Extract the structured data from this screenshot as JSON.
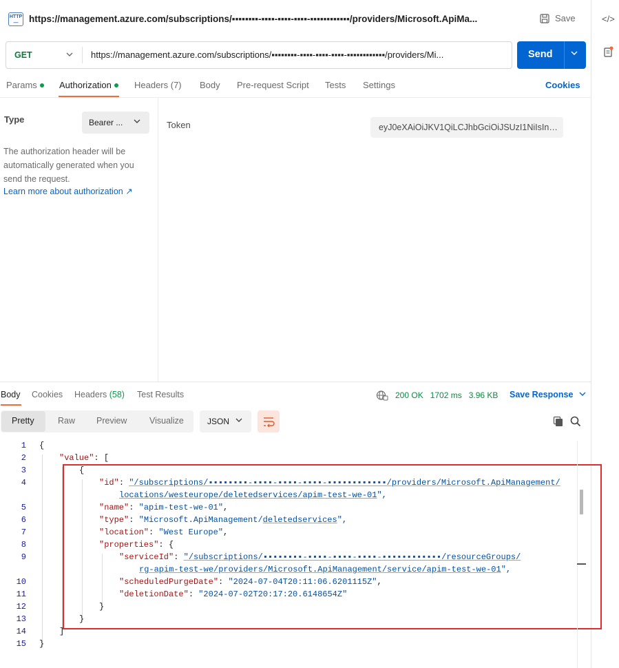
{
  "request": {
    "title": "https://management.azure.com/subscriptions/▪▪▪▪▪▪▪▪-▪▪▪▪-▪▪▪▪-▪▪▪▪-▪▪▪▪▪▪▪▪▪▪▪▪/providers/Microsoft.ApiMa...",
    "save_label": "Save",
    "method": "GET",
    "url": "https://management.azure.com/subscriptions/▪▪▪▪▪▪▪▪-▪▪▪▪-▪▪▪▪-▪▪▪▪-▪▪▪▪▪▪▪▪▪▪▪▪/providers/Mi...",
    "send_label": "Send",
    "tabs": [
      {
        "label": "Params",
        "dot": true
      },
      {
        "label": "Authorization",
        "dot": true,
        "active": true
      },
      {
        "label": "Headers (7)"
      },
      {
        "label": "Body"
      },
      {
        "label": "Pre-request Script"
      },
      {
        "label": "Tests"
      },
      {
        "label": "Settings"
      }
    ],
    "cookies_link": "Cookies"
  },
  "auth": {
    "type_label": "Type",
    "type_value": "Bearer ...",
    "description": "The authorization header will be automatically generated when you send the request.",
    "learn_more": "Learn more about authorization ↗",
    "token_label": "Token",
    "token_value": "eyJ0eXAiOiJKV1QiLCJhbGciOiJSUzI1NiIsIng..."
  },
  "response": {
    "tabs": [
      {
        "label": "Body",
        "active": true
      },
      {
        "label": "Cookies"
      },
      {
        "label": "Headers",
        "count": "(58)"
      },
      {
        "label": "Test Results"
      }
    ],
    "status": "200 OK",
    "time": "1702 ms",
    "size": "3.96 KB",
    "save_response": "Save Response",
    "view_modes": [
      "Pretty",
      "Raw",
      "Preview",
      "Visualize"
    ],
    "format": "JSON",
    "colors": {
      "status_ok": "#0d8a42",
      "accent": "#f26b3a",
      "link": "#0265d2",
      "highlight_box": "#e32b2b"
    },
    "code": {
      "line_numbers": [
        "1",
        "2",
        "3",
        "4",
        "5",
        "6",
        "7",
        "8",
        "9",
        "10",
        "11",
        "12",
        "13",
        "14",
        "15"
      ],
      "l1": "{",
      "l2_key": "\"value\"",
      "l2_rest": ": [",
      "l3": "{",
      "l4_key": "\"id\"",
      "l4_colon": ": ",
      "l4_val_a": "\"/subscriptions/▪▪▪▪▪▪▪▪-▪▪▪▪-▪▪▪▪-▪▪▪▪-▪▪▪▪▪▪▪▪▪▪▪▪/providers/Microsoft.ApiManagement/",
      "l4_val_b": "locations/westeurope/deletedservices/apim-test-we-01",
      "l4_end": "\",",
      "l5_key": "\"name\"",
      "l5_val": "\"apim-test-we-01\"",
      "l6_key": "\"type\"",
      "l6_val_a": "\"Microsoft.ApiManagement/",
      "l6_val_b": "deletedservices",
      "l6_end": "\",",
      "l7_key": "\"location\"",
      "l7_val": "\"West Europe\"",
      "l8_key": "\"properties\"",
      "l8_rest": ": {",
      "l9_key": "\"serviceId\"",
      "l9_val_a": "\"/subscriptions/▪▪▪▪▪▪▪▪-▪▪▪▪-▪▪▪▪-▪▪▪▪-▪▪▪▪▪▪▪▪▪▪▪▪/resourceGroups/",
      "l9_val_b": "rg-apim-test-we/providers/Microsoft.ApiManagement/service/apim-test-we-01",
      "l9_end": "\",",
      "l10_key": "\"scheduledPurgeDate\"",
      "l10_val": "\"2024-07-04T20:11:06.6201115Z\"",
      "l11_key": "\"deletionDate\"",
      "l11_val": "\"2024-07-02T20:17:20.6148654Z\"",
      "l12": "}",
      "l13": "}",
      "l14": "]",
      "l15": "}"
    }
  }
}
